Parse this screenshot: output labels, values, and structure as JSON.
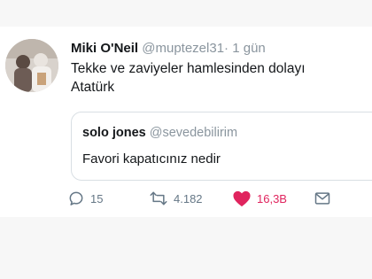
{
  "tweet": {
    "display_name": "Miki O'Neil",
    "handle": "@muptezel31",
    "separator": "·",
    "time": "1 gün",
    "text_line1": "Tekke ve zaviyeler hamlesinden dolayı",
    "text_line2": "Atatürk"
  },
  "quote": {
    "display_name": "solo jones",
    "handle": "@sevedebilirim",
    "text": "Favori kapatıcınız nedir"
  },
  "actions": {
    "reply_count": "15",
    "retweet_count": "4.182",
    "like_count": "16,3B",
    "icons": {
      "reply": "reply-icon",
      "retweet": "retweet-icon",
      "like": "heart-icon",
      "share": "mail-icon"
    }
  },
  "colors": {
    "like_active": "#e0245e",
    "muted_text": "#8a959e",
    "border": "#d9dfe4"
  }
}
